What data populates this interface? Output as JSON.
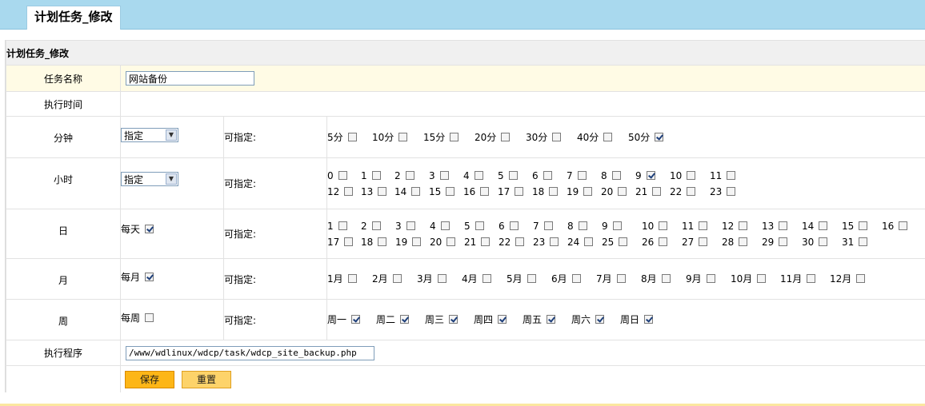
{
  "tab": {
    "title": "计划任务_修改"
  },
  "form": {
    "heading": "计划任务_修改",
    "task_name": {
      "label": "任务名称",
      "value": "网站备份"
    },
    "exec_time_label": "执行时间",
    "selectable_label": "可指定:",
    "minute": {
      "label": "分钟",
      "select_value": "指定",
      "options": [
        {
          "label": "5分",
          "checked": false
        },
        {
          "label": "10分",
          "checked": false
        },
        {
          "label": "15分",
          "checked": false
        },
        {
          "label": "20分",
          "checked": false
        },
        {
          "label": "30分",
          "checked": false
        },
        {
          "label": "40分",
          "checked": false
        },
        {
          "label": "50分",
          "checked": true
        }
      ]
    },
    "hour": {
      "label": "小时",
      "select_value": "指定",
      "rows": [
        [
          {
            "label": "0",
            "checked": false
          },
          {
            "label": "1",
            "checked": false
          },
          {
            "label": "2",
            "checked": false
          },
          {
            "label": "3",
            "checked": false
          },
          {
            "label": "4",
            "checked": false
          },
          {
            "label": "5",
            "checked": false
          },
          {
            "label": "6",
            "checked": false
          },
          {
            "label": "7",
            "checked": false
          },
          {
            "label": "8",
            "checked": false
          },
          {
            "label": "9",
            "checked": true
          },
          {
            "label": "10",
            "checked": false
          },
          {
            "label": "11",
            "checked": false
          }
        ],
        [
          {
            "label": "12",
            "checked": false
          },
          {
            "label": "13",
            "checked": false
          },
          {
            "label": "14",
            "checked": false
          },
          {
            "label": "15",
            "checked": false
          },
          {
            "label": "16",
            "checked": false
          },
          {
            "label": "17",
            "checked": false
          },
          {
            "label": "18",
            "checked": false
          },
          {
            "label": "19",
            "checked": false
          },
          {
            "label": "20",
            "checked": false
          },
          {
            "label": "21",
            "checked": false
          },
          {
            "label": "22",
            "checked": false
          },
          {
            "label": "23",
            "checked": false
          }
        ]
      ]
    },
    "day": {
      "label": "日",
      "every_label": "每天",
      "every_checked": true,
      "rows": [
        [
          {
            "label": "1",
            "checked": false
          },
          {
            "label": "2",
            "checked": false
          },
          {
            "label": "3",
            "checked": false
          },
          {
            "label": "4",
            "checked": false
          },
          {
            "label": "5",
            "checked": false
          },
          {
            "label": "6",
            "checked": false
          },
          {
            "label": "7",
            "checked": false
          },
          {
            "label": "8",
            "checked": false
          },
          {
            "label": "9",
            "checked": false
          },
          {
            "label": "10",
            "checked": false
          },
          {
            "label": "11",
            "checked": false
          },
          {
            "label": "12",
            "checked": false
          },
          {
            "label": "13",
            "checked": false
          },
          {
            "label": "14",
            "checked": false
          },
          {
            "label": "15",
            "checked": false
          },
          {
            "label": "16",
            "checked": false
          }
        ],
        [
          {
            "label": "17",
            "checked": false
          },
          {
            "label": "18",
            "checked": false
          },
          {
            "label": "19",
            "checked": false
          },
          {
            "label": "20",
            "checked": false
          },
          {
            "label": "21",
            "checked": false
          },
          {
            "label": "22",
            "checked": false
          },
          {
            "label": "23",
            "checked": false
          },
          {
            "label": "24",
            "checked": false
          },
          {
            "label": "25",
            "checked": false
          },
          {
            "label": "26",
            "checked": false
          },
          {
            "label": "27",
            "checked": false
          },
          {
            "label": "28",
            "checked": false
          },
          {
            "label": "29",
            "checked": false
          },
          {
            "label": "30",
            "checked": false
          },
          {
            "label": "31",
            "checked": false
          }
        ]
      ]
    },
    "month": {
      "label": "月",
      "every_label": "每月",
      "every_checked": true,
      "options": [
        {
          "label": "1月",
          "checked": false
        },
        {
          "label": "2月",
          "checked": false
        },
        {
          "label": "3月",
          "checked": false
        },
        {
          "label": "4月",
          "checked": false
        },
        {
          "label": "5月",
          "checked": false
        },
        {
          "label": "6月",
          "checked": false
        },
        {
          "label": "7月",
          "checked": false
        },
        {
          "label": "8月",
          "checked": false
        },
        {
          "label": "9月",
          "checked": false
        },
        {
          "label": "10月",
          "checked": false
        },
        {
          "label": "11月",
          "checked": false
        },
        {
          "label": "12月",
          "checked": false
        }
      ]
    },
    "week": {
      "label": "周",
      "every_label": "每周",
      "every_checked": false,
      "options": [
        {
          "label": "周一",
          "checked": true
        },
        {
          "label": "周二",
          "checked": true
        },
        {
          "label": "周三",
          "checked": true
        },
        {
          "label": "周四",
          "checked": true
        },
        {
          "label": "周五",
          "checked": true
        },
        {
          "label": "周六",
          "checked": true
        },
        {
          "label": "周日",
          "checked": true
        }
      ]
    },
    "program": {
      "label": "执行程序",
      "value": "/www/wdlinux/wdcp/task/wdcp_site_backup.php"
    },
    "buttons": {
      "save": "保存",
      "reset": "重置"
    }
  }
}
